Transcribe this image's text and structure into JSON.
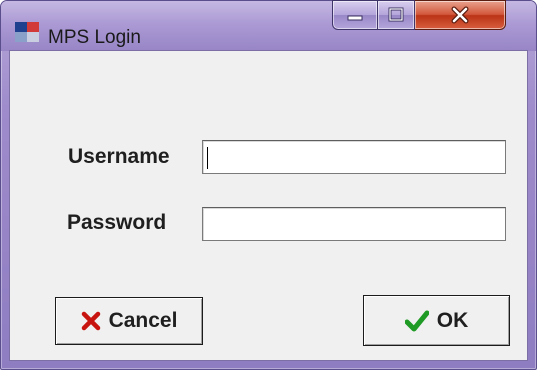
{
  "window": {
    "title": "MPS Login",
    "app_icon": "mps-app-icon",
    "controls": {
      "minimize_icon": "minimize-icon",
      "maximize_icon": "maximize-icon",
      "close_icon": "close-icon"
    },
    "colors": {
      "frame": "#9d8bcb",
      "close_button": "#c8442a",
      "client_background": "#f0f0f0"
    }
  },
  "form": {
    "username_label": "Username",
    "username_value": "",
    "password_label": "Password",
    "password_value": ""
  },
  "buttons": {
    "cancel_label": "Cancel",
    "cancel_icon": "red-x-icon",
    "ok_label": "OK",
    "ok_icon": "green-checkmark-icon"
  }
}
